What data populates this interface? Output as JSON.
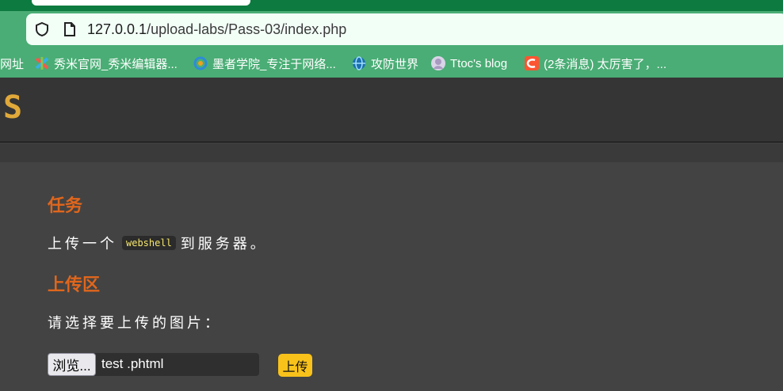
{
  "browser": {
    "url_host": "127.0.0.1",
    "url_path": "/upload-labs/Pass-03/index.php"
  },
  "bookmarks": [
    {
      "label": "网址",
      "icon": "none"
    },
    {
      "label": "秀米官网_秀米编辑器...",
      "icon": "xiumi-icon"
    },
    {
      "label": "墨者学院_专注于网络...",
      "icon": "mozhe-icon"
    },
    {
      "label": "攻防世界",
      "icon": "globe-icon"
    },
    {
      "label": "Ttoc's blog",
      "icon": "avatar-icon"
    },
    {
      "label": "(2条消息) 太厉害了，...",
      "icon": "csdn-icon"
    }
  ],
  "header": {
    "logo_text": "S"
  },
  "content": {
    "task_heading": "任务",
    "task_prefix": "上传一个",
    "task_code": "webshell",
    "task_suffix": "到服务器。",
    "upload_heading": "上传区",
    "choose_prompt": "请选择要上传的图片：",
    "browse_label": "浏览...",
    "file_name": "test .phtml",
    "upload_label": "上传"
  },
  "colors": {
    "accent_heading": "#e0661c",
    "upload_button": "#f8c21b",
    "code_text": "#f7e76b",
    "browser_green": "#4aad75"
  }
}
